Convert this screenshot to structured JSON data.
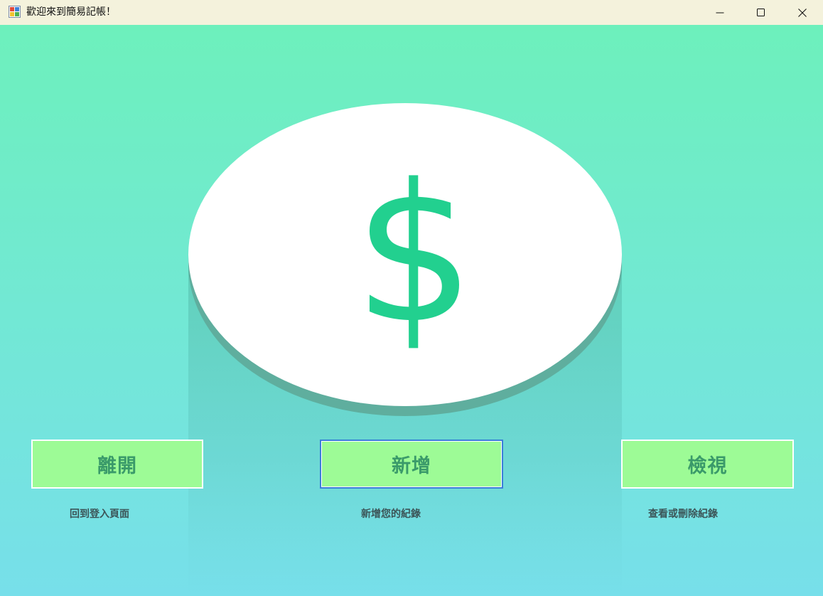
{
  "window": {
    "title": "歡迎來到簡易記帳！",
    "controls": [
      "minimize",
      "maximize",
      "close"
    ]
  },
  "hero": {
    "icon": "dollar-sign-icon",
    "accent_color": "#22d08f"
  },
  "actions": [
    {
      "label": "離開",
      "caption": "回到登入頁面"
    },
    {
      "label": "新增",
      "caption": "新增您的紀錄"
    },
    {
      "label": "檢視",
      "caption": "查看或刪除紀錄"
    }
  ],
  "colors": {
    "button_fill": "#9dfb96",
    "button_text": "#3a9a6a",
    "focus_border": "#3a7fd8",
    "background_top": "#6df0bc",
    "background_bottom": "#77dfea",
    "titlebar": "#f4f2dc"
  }
}
